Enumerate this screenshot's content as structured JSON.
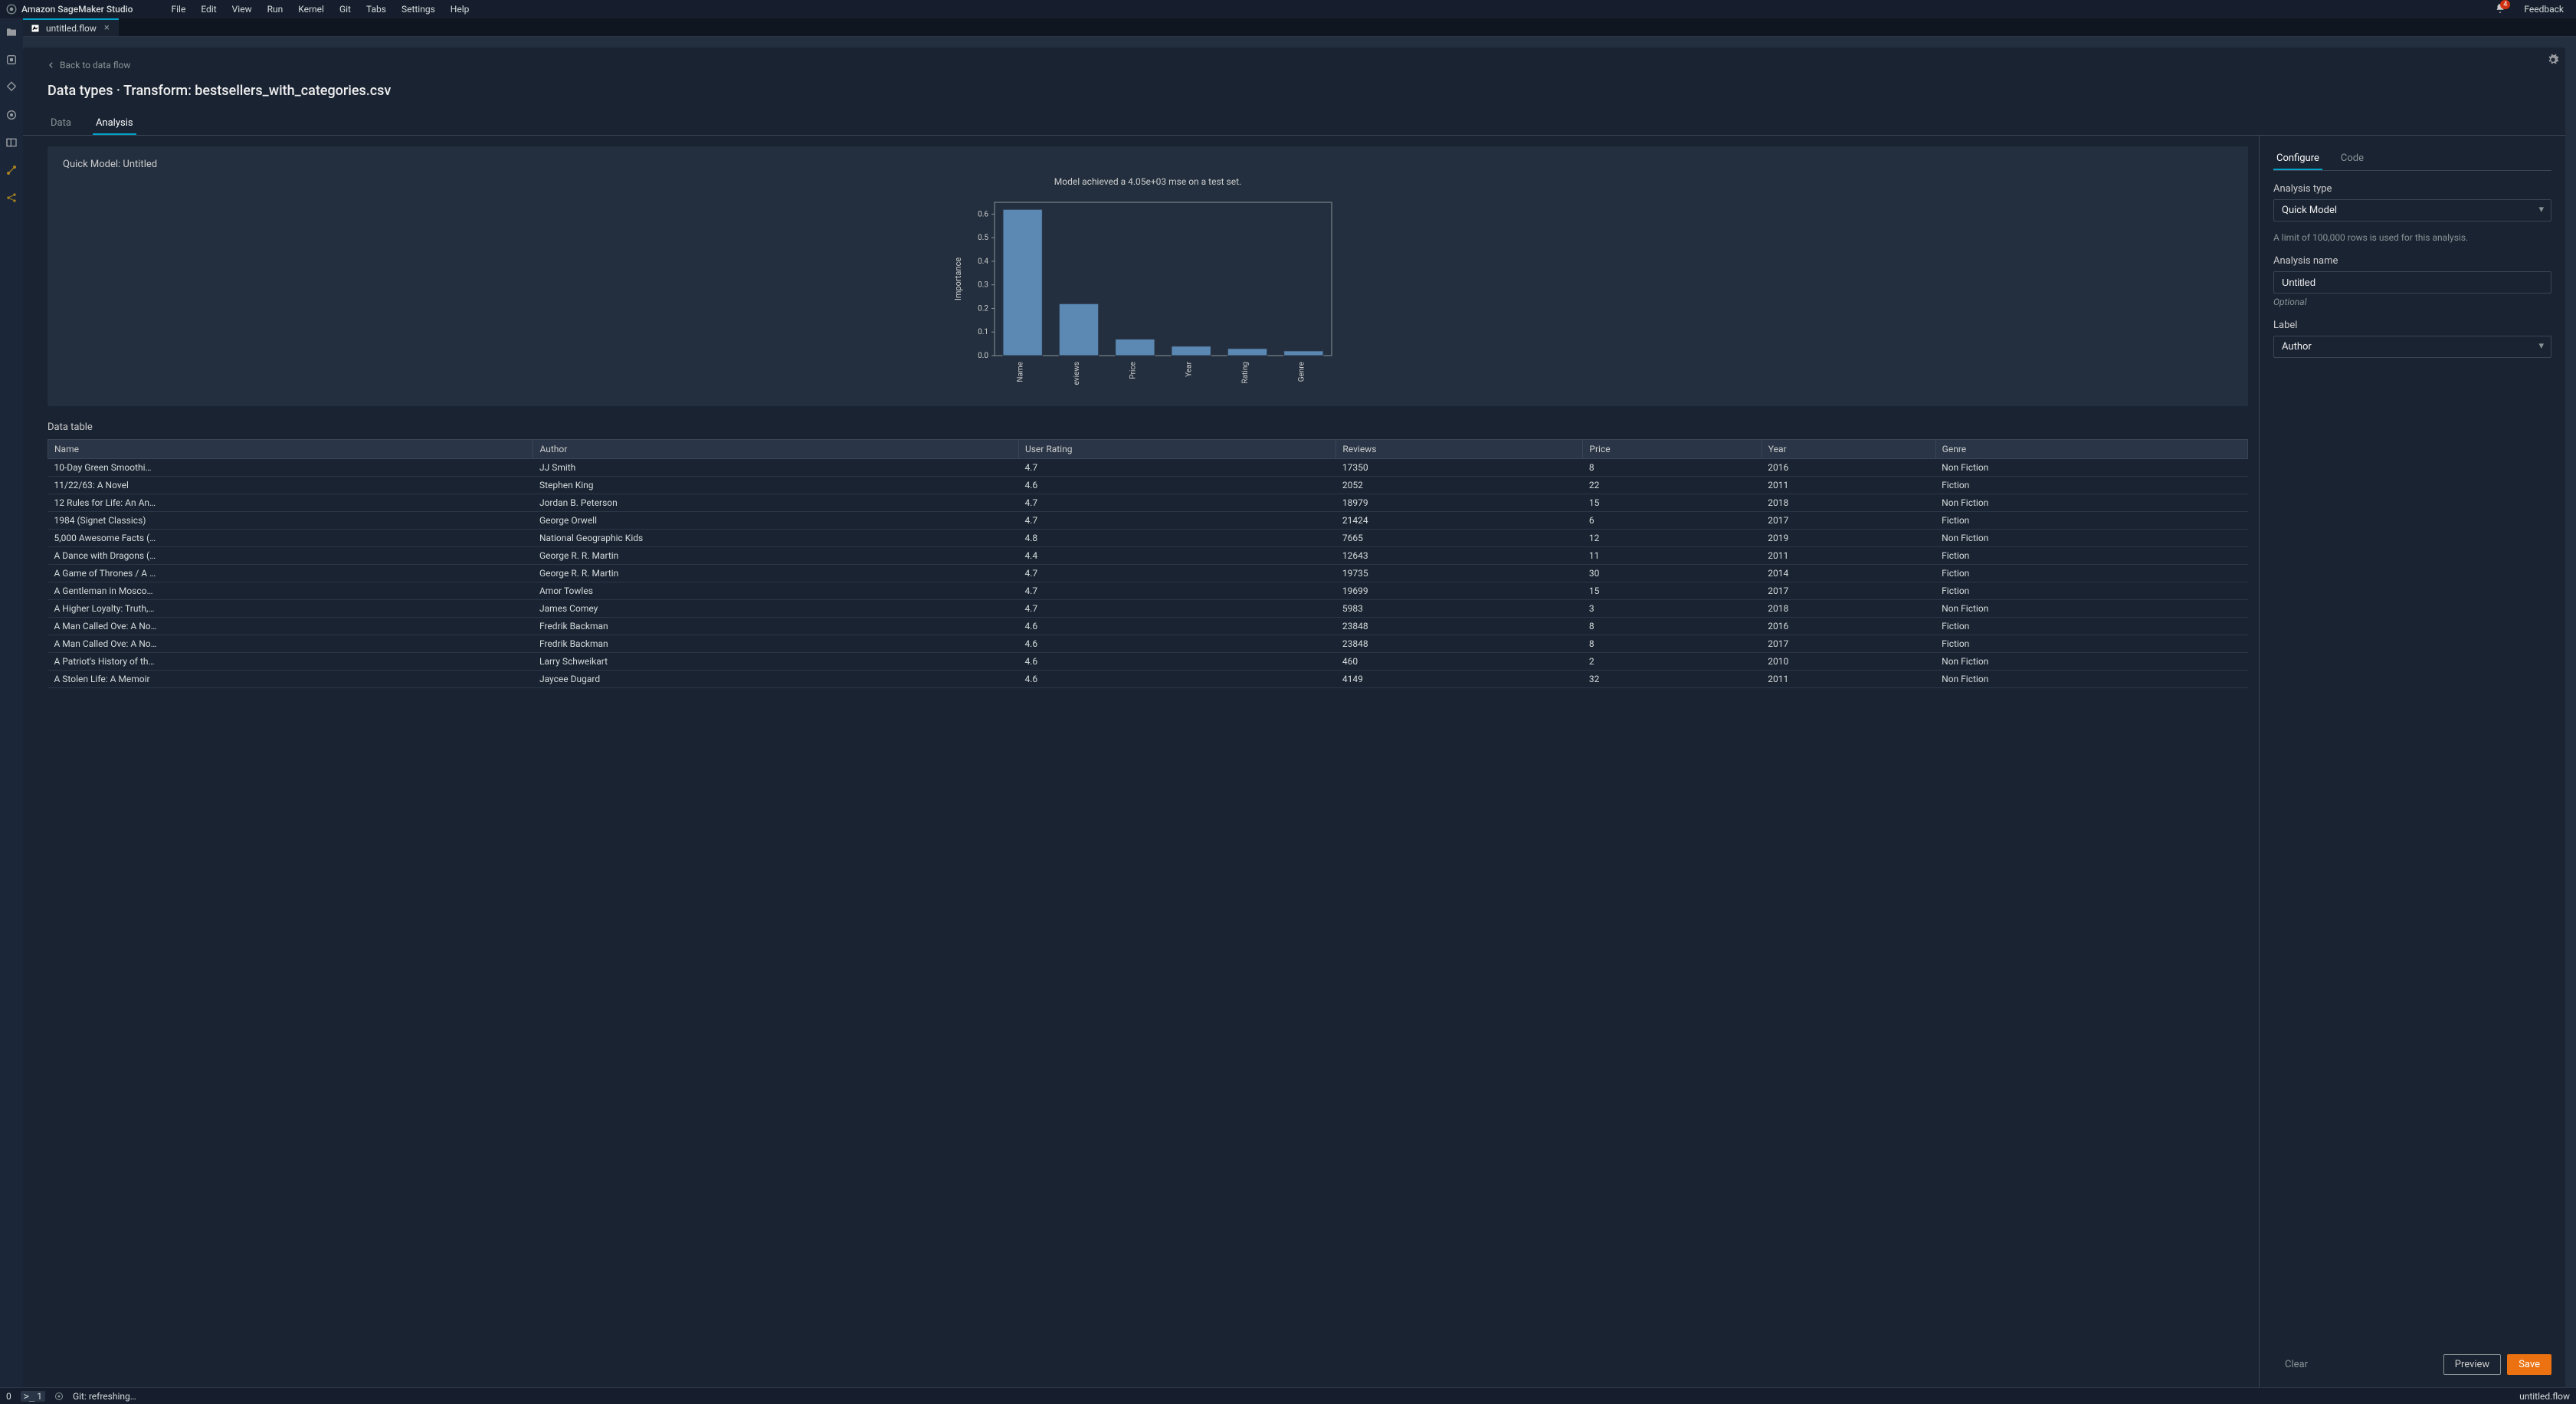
{
  "topbar": {
    "brand": "Amazon SageMaker Studio",
    "menus": [
      "File",
      "Edit",
      "View",
      "Run",
      "Kernel",
      "Git",
      "Tabs",
      "Settings",
      "Help"
    ],
    "notification_count": "4",
    "feedback": "Feedback"
  },
  "tab": {
    "title": "untitled.flow"
  },
  "header": {
    "back": "Back to data flow",
    "title": "Data types · Transform: bestsellers_with_categories.csv"
  },
  "sub_tabs": {
    "data": "Data",
    "analysis": "Analysis"
  },
  "chart": {
    "card_title": "Quick Model: Untitled",
    "mse_line": "Model achieved a 4.05e+03 mse on a test set."
  },
  "chart_data": {
    "type": "bar",
    "title": "",
    "xlabel": "",
    "ylabel": "Importance",
    "ylim": [
      0.0,
      0.65
    ],
    "yticks": [
      0.0,
      0.1,
      0.2,
      0.3,
      0.4,
      0.5,
      0.6
    ],
    "categories": [
      "Name",
      "eviews",
      "Price",
      "Year",
      "Rating",
      "Genre"
    ],
    "values": [
      0.62,
      0.22,
      0.07,
      0.04,
      0.03,
      0.02
    ]
  },
  "table": {
    "title": "Data table",
    "columns": [
      "Name",
      "Author",
      "User Rating",
      "Reviews",
      "Price",
      "Year",
      "Genre"
    ],
    "rows": [
      [
        "10-Day Green Smoothi…",
        "JJ Smith",
        "4.7",
        "17350",
        "8",
        "2016",
        "Non Fiction"
      ],
      [
        "11/22/63: A Novel",
        "Stephen King",
        "4.6",
        "2052",
        "22",
        "2011",
        "Fiction"
      ],
      [
        "12 Rules for Life: An An…",
        "Jordan B. Peterson",
        "4.7",
        "18979",
        "15",
        "2018",
        "Non Fiction"
      ],
      [
        "1984 (Signet Classics)",
        "George Orwell",
        "4.7",
        "21424",
        "6",
        "2017",
        "Fiction"
      ],
      [
        "5,000 Awesome Facts (…",
        "National Geographic Kids",
        "4.8",
        "7665",
        "12",
        "2019",
        "Non Fiction"
      ],
      [
        "A Dance with Dragons (…",
        "George R. R. Martin",
        "4.4",
        "12643",
        "11",
        "2011",
        "Fiction"
      ],
      [
        "A Game of Thrones / A …",
        "George R. R. Martin",
        "4.7",
        "19735",
        "30",
        "2014",
        "Fiction"
      ],
      [
        "A Gentleman in Mosco…",
        "Amor Towles",
        "4.7",
        "19699",
        "15",
        "2017",
        "Fiction"
      ],
      [
        "A Higher Loyalty: Truth,…",
        "James Comey",
        "4.7",
        "5983",
        "3",
        "2018",
        "Non Fiction"
      ],
      [
        "A Man Called Ove: A No…",
        "Fredrik Backman",
        "4.6",
        "23848",
        "8",
        "2016",
        "Fiction"
      ],
      [
        "A Man Called Ove: A No…",
        "Fredrik Backman",
        "4.6",
        "23848",
        "8",
        "2017",
        "Fiction"
      ],
      [
        "A Patriot's History of th…",
        "Larry Schweikart",
        "4.6",
        "460",
        "2",
        "2010",
        "Non Fiction"
      ],
      [
        "A Stolen Life: A Memoir",
        "Jaycee Dugard",
        "4.6",
        "4149",
        "32",
        "2011",
        "Non Fiction"
      ]
    ]
  },
  "right": {
    "tabs": {
      "configure": "Configure",
      "code": "Code"
    },
    "analysis_type_label": "Analysis type",
    "analysis_type_value": "Quick Model",
    "rows_hint": "A limit of 100,000 rows is used for this analysis.",
    "analysis_name_label": "Analysis name",
    "analysis_name_value": "Untitled",
    "optional": "Optional",
    "label_label": "Label",
    "label_value": "Author",
    "clear": "Clear",
    "preview": "Preview",
    "save": "Save"
  },
  "statusbar": {
    "zero": "0",
    "terminal": "1",
    "git": "Git: refreshing…",
    "filename": "untitled.flow"
  }
}
